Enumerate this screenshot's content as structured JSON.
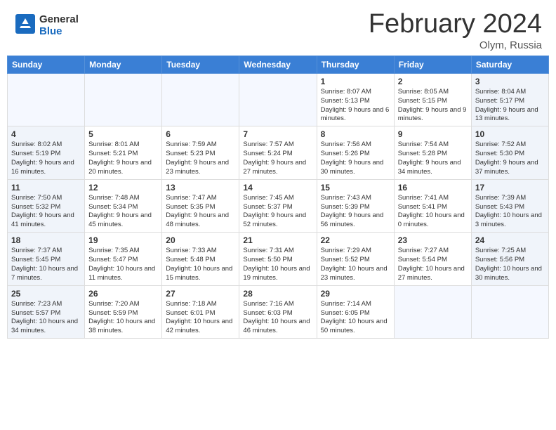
{
  "header": {
    "logo_general": "General",
    "logo_blue": "Blue",
    "title": "February 2024",
    "subtitle": "Olym, Russia"
  },
  "weekdays": [
    "Sunday",
    "Monday",
    "Tuesday",
    "Wednesday",
    "Thursday",
    "Friday",
    "Saturday"
  ],
  "weeks": [
    [
      {
        "day": "",
        "empty": true
      },
      {
        "day": "",
        "empty": true
      },
      {
        "day": "",
        "empty": true
      },
      {
        "day": "",
        "empty": true
      },
      {
        "day": "1",
        "sunrise": "8:07 AM",
        "sunset": "5:13 PM",
        "daylight": "9 hours and 6 minutes."
      },
      {
        "day": "2",
        "sunrise": "8:05 AM",
        "sunset": "5:15 PM",
        "daylight": "9 hours and 9 minutes."
      },
      {
        "day": "3",
        "sunrise": "8:04 AM",
        "sunset": "5:17 PM",
        "daylight": "9 hours and 13 minutes."
      }
    ],
    [
      {
        "day": "4",
        "sunrise": "8:02 AM",
        "sunset": "5:19 PM",
        "daylight": "9 hours and 16 minutes."
      },
      {
        "day": "5",
        "sunrise": "8:01 AM",
        "sunset": "5:21 PM",
        "daylight": "9 hours and 20 minutes."
      },
      {
        "day": "6",
        "sunrise": "7:59 AM",
        "sunset": "5:23 PM",
        "daylight": "9 hours and 23 minutes."
      },
      {
        "day": "7",
        "sunrise": "7:57 AM",
        "sunset": "5:24 PM",
        "daylight": "9 hours and 27 minutes."
      },
      {
        "day": "8",
        "sunrise": "7:56 AM",
        "sunset": "5:26 PM",
        "daylight": "9 hours and 30 minutes."
      },
      {
        "day": "9",
        "sunrise": "7:54 AM",
        "sunset": "5:28 PM",
        "daylight": "9 hours and 34 minutes."
      },
      {
        "day": "10",
        "sunrise": "7:52 AM",
        "sunset": "5:30 PM",
        "daylight": "9 hours and 37 minutes."
      }
    ],
    [
      {
        "day": "11",
        "sunrise": "7:50 AM",
        "sunset": "5:32 PM",
        "daylight": "9 hours and 41 minutes."
      },
      {
        "day": "12",
        "sunrise": "7:48 AM",
        "sunset": "5:34 PM",
        "daylight": "9 hours and 45 minutes."
      },
      {
        "day": "13",
        "sunrise": "7:47 AM",
        "sunset": "5:35 PM",
        "daylight": "9 hours and 48 minutes."
      },
      {
        "day": "14",
        "sunrise": "7:45 AM",
        "sunset": "5:37 PM",
        "daylight": "9 hours and 52 minutes."
      },
      {
        "day": "15",
        "sunrise": "7:43 AM",
        "sunset": "5:39 PM",
        "daylight": "9 hours and 56 minutes."
      },
      {
        "day": "16",
        "sunrise": "7:41 AM",
        "sunset": "5:41 PM",
        "daylight": "10 hours and 0 minutes."
      },
      {
        "day": "17",
        "sunrise": "7:39 AM",
        "sunset": "5:43 PM",
        "daylight": "10 hours and 3 minutes."
      }
    ],
    [
      {
        "day": "18",
        "sunrise": "7:37 AM",
        "sunset": "5:45 PM",
        "daylight": "10 hours and 7 minutes."
      },
      {
        "day": "19",
        "sunrise": "7:35 AM",
        "sunset": "5:47 PM",
        "daylight": "10 hours and 11 minutes."
      },
      {
        "day": "20",
        "sunrise": "7:33 AM",
        "sunset": "5:48 PM",
        "daylight": "10 hours and 15 minutes."
      },
      {
        "day": "21",
        "sunrise": "7:31 AM",
        "sunset": "5:50 PM",
        "daylight": "10 hours and 19 minutes."
      },
      {
        "day": "22",
        "sunrise": "7:29 AM",
        "sunset": "5:52 PM",
        "daylight": "10 hours and 23 minutes."
      },
      {
        "day": "23",
        "sunrise": "7:27 AM",
        "sunset": "5:54 PM",
        "daylight": "10 hours and 27 minutes."
      },
      {
        "day": "24",
        "sunrise": "7:25 AM",
        "sunset": "5:56 PM",
        "daylight": "10 hours and 30 minutes."
      }
    ],
    [
      {
        "day": "25",
        "sunrise": "7:23 AM",
        "sunset": "5:57 PM",
        "daylight": "10 hours and 34 minutes."
      },
      {
        "day": "26",
        "sunrise": "7:20 AM",
        "sunset": "5:59 PM",
        "daylight": "10 hours and 38 minutes."
      },
      {
        "day": "27",
        "sunrise": "7:18 AM",
        "sunset": "6:01 PM",
        "daylight": "10 hours and 42 minutes."
      },
      {
        "day": "28",
        "sunrise": "7:16 AM",
        "sunset": "6:03 PM",
        "daylight": "10 hours and 46 minutes."
      },
      {
        "day": "29",
        "sunrise": "7:14 AM",
        "sunset": "6:05 PM",
        "daylight": "10 hours and 50 minutes."
      },
      {
        "day": "",
        "empty": true
      },
      {
        "day": "",
        "empty": true
      }
    ]
  ]
}
